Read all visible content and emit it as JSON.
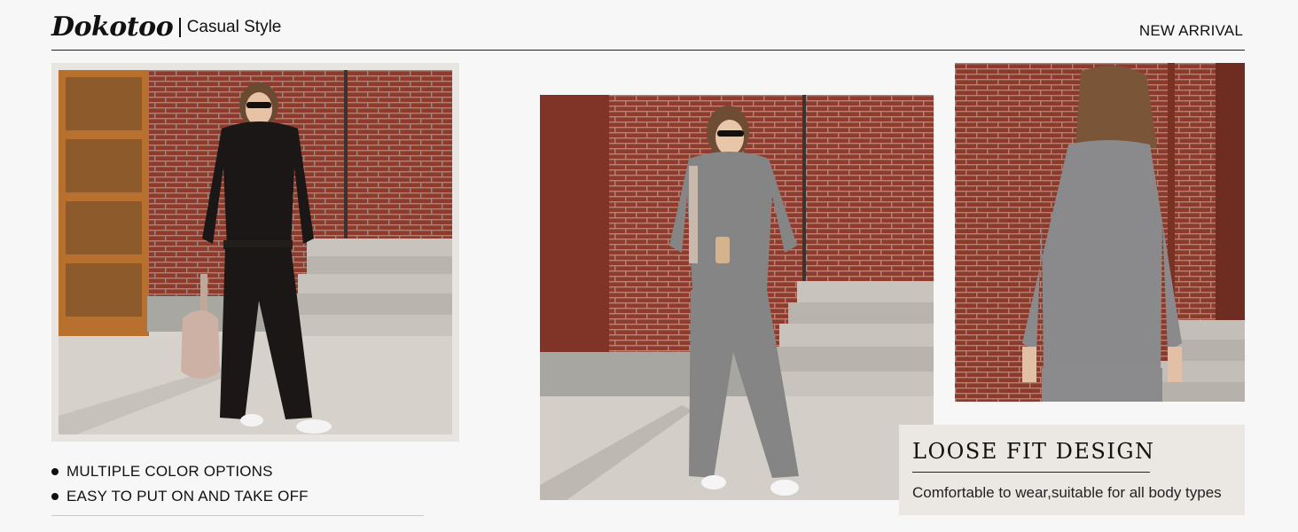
{
  "header": {
    "brand": "Dokotoo",
    "tagline": "Casual Style",
    "badge": "NEW ARRIVAL"
  },
  "photos": [
    {
      "name": "black-outfit-photo",
      "outfit_color": "#1a1716"
    },
    {
      "name": "grey-outfit-front-photo",
      "outfit_color": "#858585"
    },
    {
      "name": "grey-outfit-back-photo",
      "outfit_color": "#8a8a8c"
    }
  ],
  "features": [
    "MULTIPLE COLOR OPTIONS",
    "EASY TO PUT ON AND TAKE OFF"
  ],
  "callout": {
    "title": "LOOSE FIT DESIGN",
    "subtitle": "Comfortable to wear,suitable for all body types"
  }
}
